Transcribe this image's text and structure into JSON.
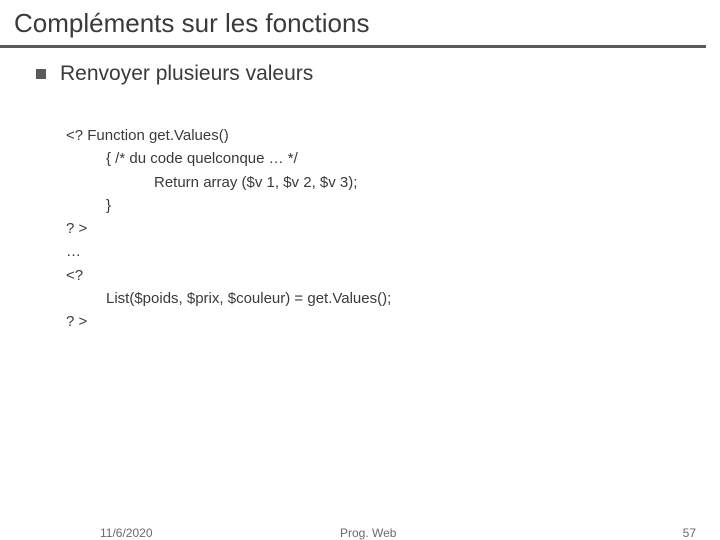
{
  "title": "Compléments sur les fonctions",
  "subtitle": "Renvoyer plusieurs valeurs",
  "code": {
    "l1": "<? Function get.Values()",
    "l2": "{ /* du code quelconque … */",
    "l3": "Return array ($v 1, $v 2, $v 3);",
    "l4": "}",
    "l5": "? >",
    "l6": "…",
    "l7": "<?",
    "l8": "List($poids, $prix, $couleur) = get.Values();",
    "l9": "? >"
  },
  "footer": {
    "date": "11/6/2020",
    "mid": "Prog. Web",
    "page": "57"
  }
}
